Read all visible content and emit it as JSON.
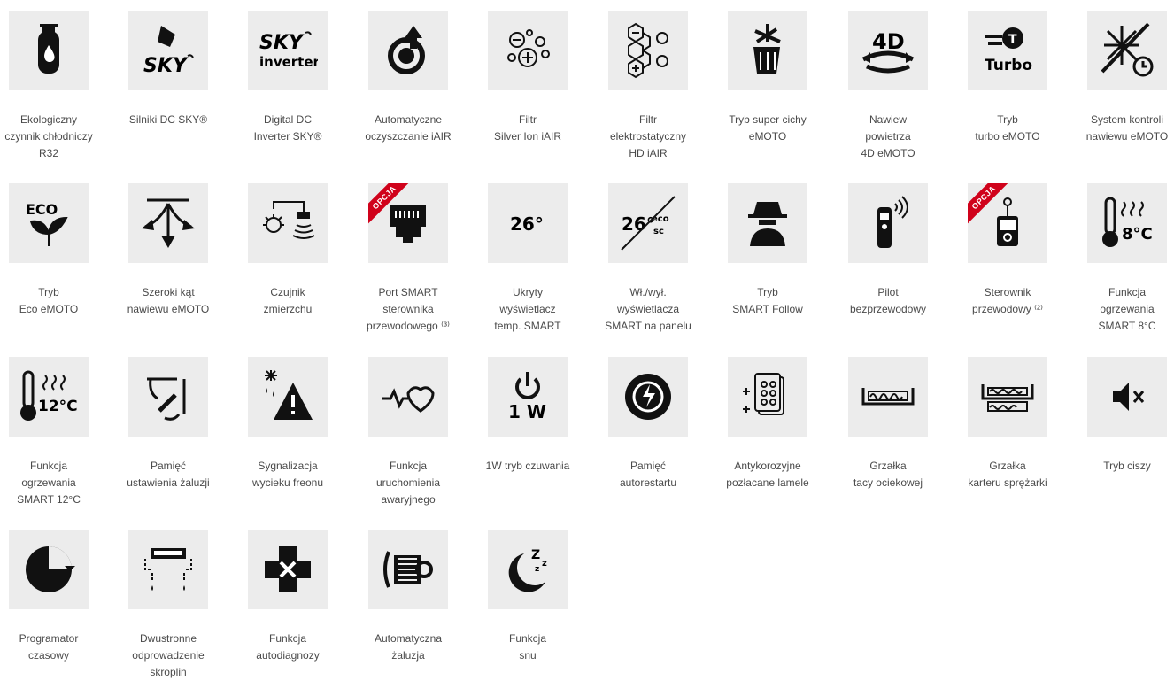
{
  "features": [
    {
      "icon": "gas-cylinder-icon",
      "label": "Ekologiczny\nczynnik chłodniczy\nR32"
    },
    {
      "icon": "sky-dc-motor-icon",
      "label": "Silniki DC SKY®",
      "tile_text": "SKY"
    },
    {
      "icon": "sky-inverter-icon",
      "label": "Digital DC\nInverter SKY®",
      "tile_text": "SKY",
      "tile_text2": "inverter"
    },
    {
      "icon": "self-clean-icon",
      "label": "Automatyczne\noczyszczanie iAIR"
    },
    {
      "icon": "ion-filter-icon",
      "label": "Filtr\nSilver Ion iAIR"
    },
    {
      "icon": "electrostatic-filter-icon",
      "label": "Filtr\nelektrostatyczny\nHD iAIR"
    },
    {
      "icon": "silent-fan-icon",
      "label": "Tryb super cichy\neMOTO"
    },
    {
      "icon": "4d-airflow-icon",
      "label": "Nawiew\npowietrza\n4D eMOTO",
      "tile_text": "4D"
    },
    {
      "icon": "turbo-icon",
      "label": "Tryb\nturbo eMOTO",
      "tile_text": "Turbo"
    },
    {
      "icon": "airflow-control-icon",
      "label": "System kontroli\nnawiewu eMOTO"
    },
    {
      "icon": "eco-leaf-icon",
      "label": "Tryb\nEco eMOTO",
      "tile_text": "ECO"
    },
    {
      "icon": "wide-angle-icon",
      "label": "Szeroki kąt\nnawiewu eMOTO"
    },
    {
      "icon": "twilight-sensor-icon",
      "label": "Czujnik\nzmierzchu"
    },
    {
      "icon": "smart-port-icon",
      "label": "Port SMART\nsterownika\nprzewodowego ⁽³⁾",
      "badge": "OPCJA"
    },
    {
      "icon": "hidden-display-icon",
      "label": "Ukryty\nwyświetlacz\ntemp. SMART",
      "tile_text": "26°"
    },
    {
      "icon": "display-toggle-icon",
      "label": "Wł./wył.\nwyświetlacza\nSMART na panelu",
      "tile_text": "26°"
    },
    {
      "icon": "follow-me-icon",
      "label": "Tryb\nSMART Follow"
    },
    {
      "icon": "remote-control-icon",
      "label": "Pilot\nbezprzewodowy"
    },
    {
      "icon": "wired-controller-icon",
      "label": "Sterownik\nprzewodowy ⁽²⁾",
      "badge": "OPCJA"
    },
    {
      "icon": "heating-8c-icon",
      "label": "Funkcja\nogrzewania\nSMART 8°C",
      "tile_text": "8°C"
    },
    {
      "icon": "heating-12c-icon",
      "label": "Funkcja\nogrzewania\nSMART 12°C",
      "tile_text": "12°C"
    },
    {
      "icon": "louver-memory-icon",
      "label": "Pamięć\nustawienia żaluzji"
    },
    {
      "icon": "refrigerant-leak-icon",
      "label": "Sygnalizacja\nwycieku freonu"
    },
    {
      "icon": "emergency-start-icon",
      "label": "Funkcja\nuruchomienia\nawaryjnego"
    },
    {
      "icon": "standby-1w-icon",
      "label": "1W tryb czuwania",
      "tile_text": "1 W"
    },
    {
      "icon": "auto-restart-icon",
      "label": "Pamięć\nautorestartu"
    },
    {
      "icon": "gold-fin-icon",
      "label": "Antykorozyjne\npozłacane lamele"
    },
    {
      "icon": "drain-pan-heater-icon",
      "label": "Grzałka\ntacy ociekowej"
    },
    {
      "icon": "crankcase-heater-icon",
      "label": "Grzałka\nkarteru sprężarki"
    },
    {
      "icon": "mute-icon",
      "label": "Tryb ciszy"
    },
    {
      "icon": "timer-icon",
      "label": "Programator\nczasowy"
    },
    {
      "icon": "two-way-drain-icon",
      "label": "Dwustronne\nodprowadzenie\nskroplin"
    },
    {
      "icon": "self-diagnosis-icon",
      "label": "Funkcja\nautodiagnozy"
    },
    {
      "icon": "auto-louver-icon",
      "label": "Automatyczna\nżaluzja"
    },
    {
      "icon": "sleep-icon",
      "label": "Funkcja\nsnu"
    }
  ]
}
